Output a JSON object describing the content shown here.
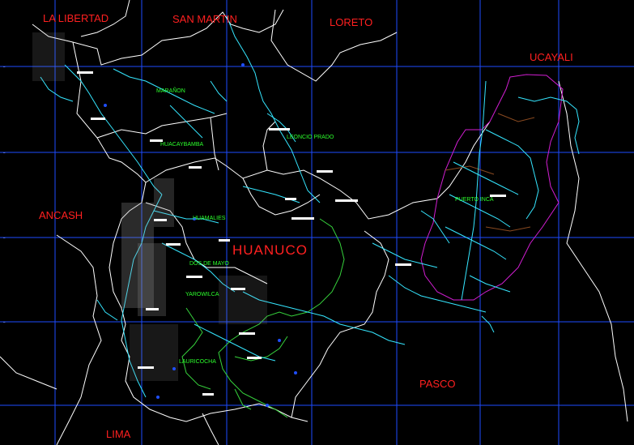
{
  "map": {
    "title": "HUANUCO",
    "regions": [
      "LA LIBERTAD",
      "SAN MARTIN",
      "LORETO",
      "UCAYALI",
      "ANCASH",
      "PASCO",
      "LIMA"
    ],
    "provinces": [
      "MARAÑON",
      "HUACAYBAMBA",
      "LEONCIO PRADO",
      "HUAMALIES",
      "PUERTO INCA",
      "DOS DE MAYO",
      "YAROWILCA",
      "LAURICOCHA"
    ],
    "colors": {
      "background": "#000000",
      "grid": "#1e4bff",
      "region_label": "#ff2020",
      "province_label": "#2cff2c",
      "rivers": "#35e6ff",
      "boundaries": "#ffffff",
      "province_limits": "#36d23c",
      "ucayali_limit": "#d21ed2"
    }
  }
}
